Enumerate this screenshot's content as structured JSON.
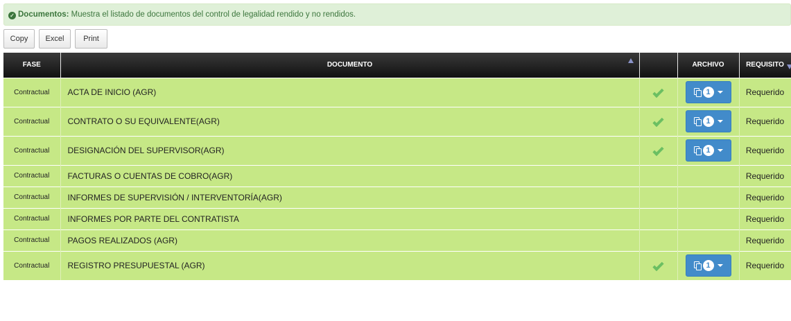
{
  "info": {
    "title": "Documentos:",
    "text": " Muestra el listado de documentos del control de legalidad rendido y no rendidos."
  },
  "buttons": {
    "copy": "Copy",
    "excel": "Excel",
    "print": "Print"
  },
  "table": {
    "headers": {
      "fase": "FASE",
      "documento": "DOCUMENTO",
      "estado": "",
      "archivo": "ARCHIVO",
      "requisito": "REQUISITO"
    },
    "rows": [
      {
        "fase": "Contractual",
        "documento": "ACTA DE INICIO (AGR)",
        "rendido": true,
        "archivos": "1",
        "requisito": "Requerido"
      },
      {
        "fase": "Contractual",
        "documento": "CONTRATO O SU EQUIVALENTE(AGR)",
        "rendido": true,
        "archivos": "1",
        "requisito": "Requerido"
      },
      {
        "fase": "Contractual",
        "documento": "DESIGNACIÓN DEL SUPERVISOR(AGR)",
        "rendido": true,
        "archivos": "1",
        "requisito": "Requerido"
      },
      {
        "fase": "Contractual",
        "documento": "FACTURAS O CUENTAS DE COBRO(AGR)",
        "rendido": false,
        "archivos": "",
        "requisito": "Requerido"
      },
      {
        "fase": "Contractual",
        "documento": "INFORMES DE SUPERVISIÓN / INTERVENTORÍA(AGR)",
        "rendido": false,
        "archivos": "",
        "requisito": "Requerido"
      },
      {
        "fase": "Contractual",
        "documento": "INFORMES POR PARTE DEL CONTRATISTA",
        "rendido": false,
        "archivos": "",
        "requisito": "Requerido"
      },
      {
        "fase": "Contractual",
        "documento": "PAGOS REALIZADOS (AGR)",
        "rendido": false,
        "archivos": "",
        "requisito": "Requerido"
      },
      {
        "fase": "Contractual",
        "documento": "REGISTRO PRESUPUESTAL (AGR)",
        "rendido": true,
        "archivos": "1",
        "requisito": "Requerido"
      }
    ]
  },
  "colors": {
    "row_bg": "#c6e886",
    "header_bg": "#111111",
    "info_bg": "#dff0d8",
    "file_button": "#428bca",
    "check": "#5cb85c"
  }
}
